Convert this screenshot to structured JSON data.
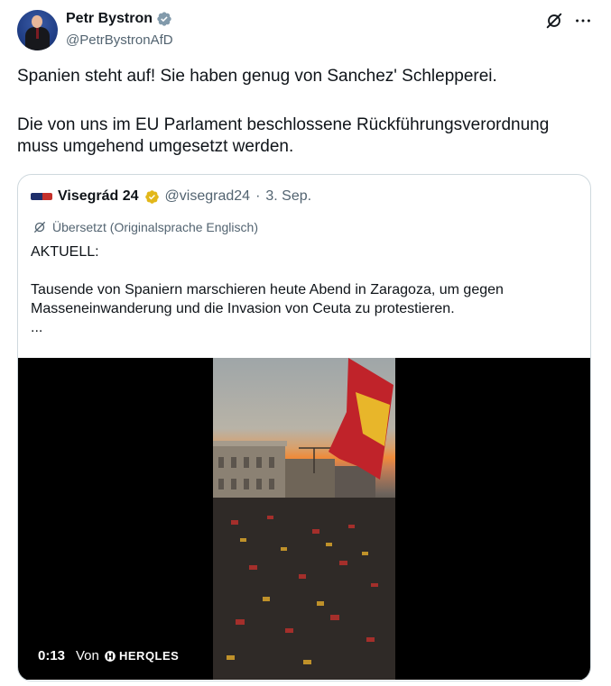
{
  "author": {
    "name": "Petr Bystron",
    "handle": "@PetrBystronAfD"
  },
  "tweet": {
    "paragraph1": "Spanien steht auf! Sie haben genug von Sanchez' Schlepperei.",
    "paragraph2": "Die von uns im EU Parlament beschlossene Rückführungsverordnung muss umgehend umgesetzt werden."
  },
  "quote": {
    "name": "Visegrád 24",
    "handle": "@visegrad24",
    "separator": "·",
    "date": "3. Sep.",
    "translated_label": "Übersetzt (Originalsprache Englisch)",
    "line1": "AKTUELL:",
    "line2": "Tausende von Spaniern marschieren heute Abend in Zaragoza, um gegen Masseneinwanderung und die Invasion von Ceuta zu protestieren.",
    "line3": "..."
  },
  "video": {
    "duration": "0:13",
    "from_label": "Von",
    "source_brand": "HERQLES"
  },
  "colors": {
    "verified_badge": "#829aab",
    "gold_badge": "#e2b719",
    "text_primary": "#0f1419",
    "text_secondary": "#536471",
    "border": "#cfd9de"
  },
  "icons": {
    "verified": "verified-badge-icon",
    "gold_verified": "gold-verified-badge-icon",
    "grok": "grok-icon",
    "more": "more-icon",
    "translate": "translate-icon"
  }
}
